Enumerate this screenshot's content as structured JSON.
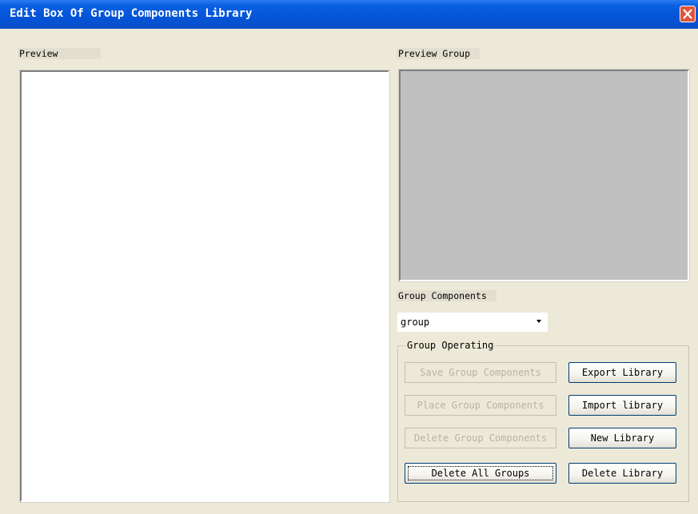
{
  "window": {
    "title": "Edit Box Of Group Components Library"
  },
  "labels": {
    "preview": "Preview",
    "preview_group": "Preview Group",
    "group_components": "Group Components"
  },
  "group_select": {
    "value": "group"
  },
  "group_operating": {
    "title": "Group Operating",
    "buttons_left": [
      {
        "label": "Save Group Components",
        "enabled": false
      },
      {
        "label": "Place Group Components",
        "enabled": false
      },
      {
        "label": "Delete Group Components",
        "enabled": false
      },
      {
        "label": "Delete All Groups",
        "enabled": true
      }
    ],
    "buttons_right": [
      {
        "label": "Export Library",
        "enabled": true
      },
      {
        "label": "Import library",
        "enabled": true
      },
      {
        "label": "New Library",
        "enabled": true
      },
      {
        "label": "Delete Library",
        "enabled": true
      }
    ]
  },
  "colors": {
    "titlebar": "#0454d8",
    "close_button": "#e0553a",
    "preview_group_bg": "#c0c0c0",
    "window_bg": "#ece9d8"
  }
}
